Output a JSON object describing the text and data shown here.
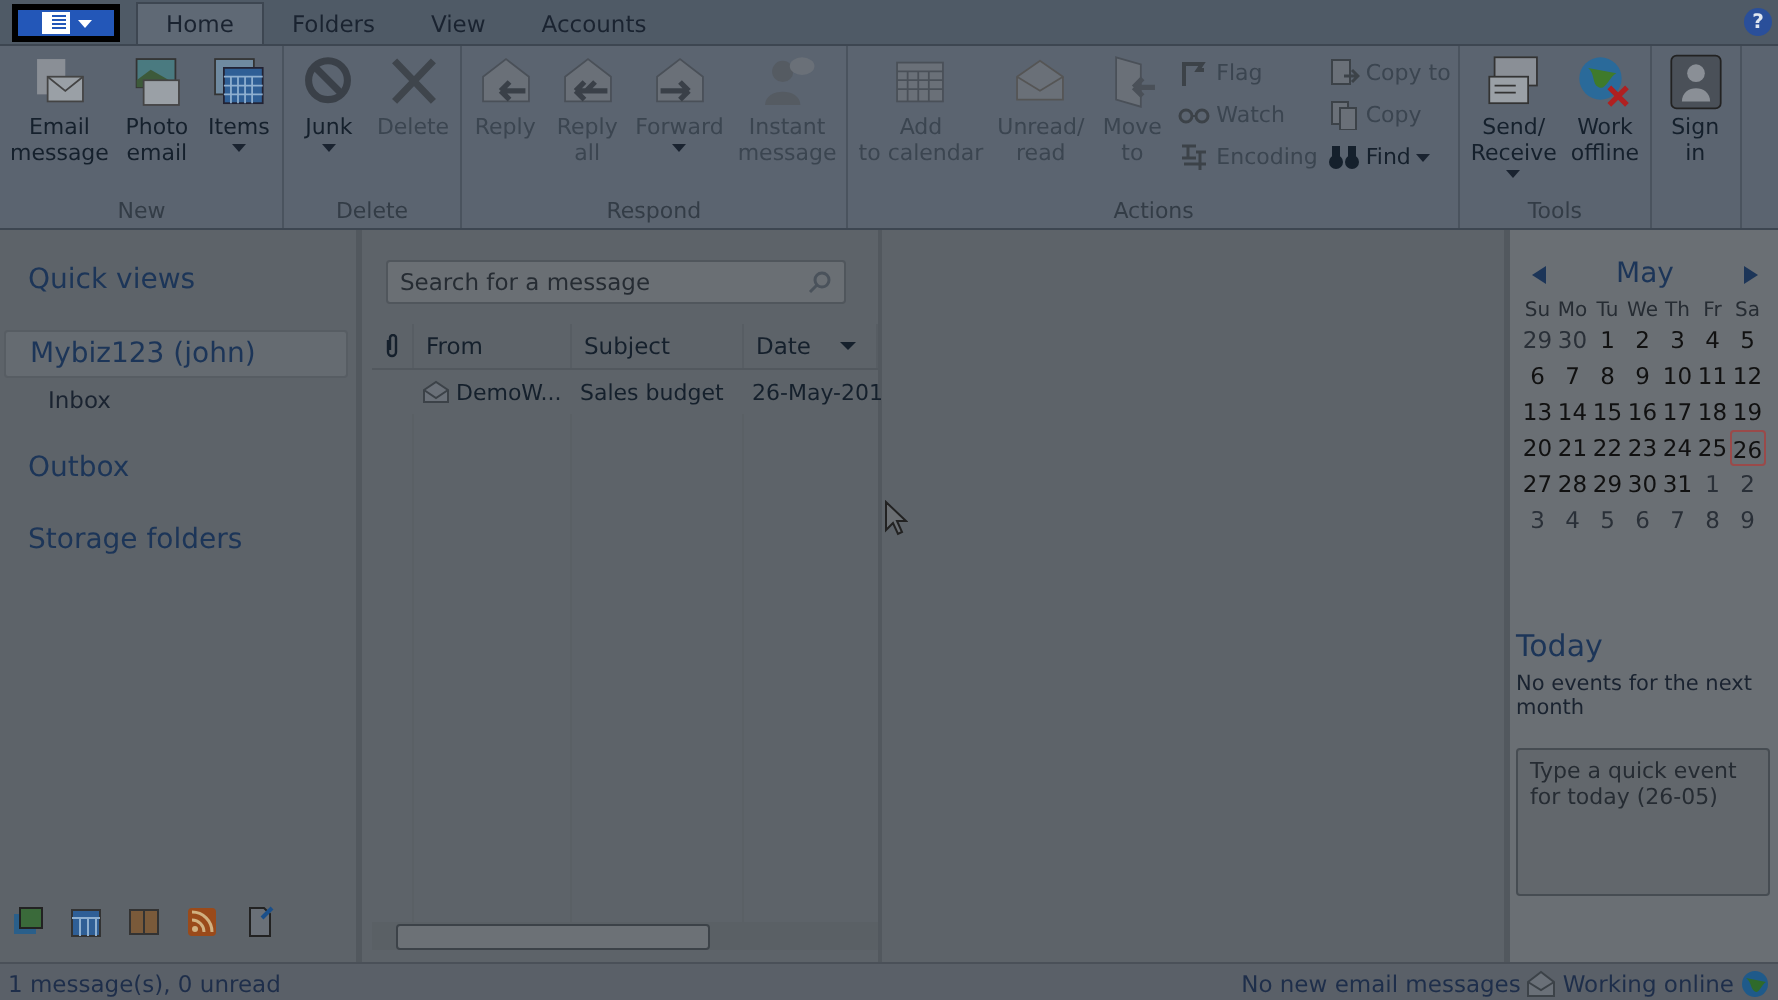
{
  "tabs": [
    {
      "label": "Home",
      "selected": true
    },
    {
      "label": "Folders",
      "selected": false
    },
    {
      "label": "View",
      "selected": false
    },
    {
      "label": "Accounts",
      "selected": false
    }
  ],
  "help_button": "?",
  "ribbon": [
    {
      "label": "New",
      "buttons": [
        {
          "kind": "large",
          "label": "Email message",
          "disabled": false,
          "dropdown": false
        },
        {
          "kind": "large",
          "label": "Photo email",
          "disabled": false,
          "dropdown": false
        },
        {
          "kind": "large",
          "label": "Items",
          "disabled": false,
          "dropdown": true
        }
      ]
    },
    {
      "label": "Delete",
      "buttons": [
        {
          "kind": "large",
          "label": "Junk",
          "disabled": false,
          "dropdown": true
        },
        {
          "kind": "large",
          "label": "Delete",
          "disabled": true,
          "dropdown": false
        }
      ]
    },
    {
      "label": "Respond",
      "buttons": [
        {
          "kind": "large",
          "label": "Reply",
          "disabled": true,
          "dropdown": false
        },
        {
          "kind": "large",
          "label": "Reply all",
          "disabled": true,
          "dropdown": false
        },
        {
          "kind": "large",
          "label": "Forward",
          "disabled": true,
          "dropdown": true
        },
        {
          "kind": "large",
          "label": "Instant message",
          "disabled": true,
          "dropdown": false
        }
      ]
    },
    {
      "label": "Actions",
      "buttons": [
        {
          "kind": "large",
          "label": "Add to calendar",
          "disabled": true,
          "dropdown": false
        },
        {
          "kind": "large",
          "label": "Unread/ read",
          "disabled": true,
          "dropdown": false
        },
        {
          "kind": "large",
          "label": "Move to",
          "disabled": true,
          "dropdown": false
        },
        {
          "kind": "small",
          "label": "Flag",
          "disabled": true,
          "dropdown": false
        },
        {
          "kind": "small",
          "label": "Watch",
          "disabled": true,
          "dropdown": false
        },
        {
          "kind": "small",
          "label": "Encoding",
          "disabled": true,
          "dropdown": false
        },
        {
          "kind": "small",
          "label": "Copy to",
          "disabled": true,
          "dropdown": false
        },
        {
          "kind": "small",
          "label": "Copy",
          "disabled": true,
          "dropdown": false
        },
        {
          "kind": "small",
          "label": "Find",
          "disabled": false,
          "dropdown": true
        }
      ]
    },
    {
      "label": "Tools",
      "buttons": [
        {
          "kind": "large",
          "label": "Send/ Receive",
          "disabled": false,
          "dropdown": true
        },
        {
          "kind": "large",
          "label": "Work offline",
          "disabled": false,
          "dropdown": false
        }
      ]
    },
    {
      "buttons": [
        {
          "kind": "large",
          "label": "Sign in",
          "disabled": false,
          "dropdown": false
        }
      ]
    }
  ],
  "sidebar": {
    "items": [
      {
        "label": "Quick views",
        "selected": false
      },
      {
        "label": "Mybiz123 (john)",
        "selected": true,
        "children": [
          {
            "label": "Inbox",
            "selected": false
          }
        ]
      },
      {
        "label": "Outbox",
        "selected": false
      },
      {
        "label": "Storage folders",
        "selected": false
      }
    ]
  },
  "search": {
    "placeholder": "Search for a message"
  },
  "table": {
    "columns": [
      "From",
      "Subject",
      "Date"
    ],
    "rows": [
      {
        "cells": [
          "DemoW...",
          "Sales budget",
          "26-May-201"
        ],
        "selected": false
      }
    ]
  },
  "calendar": {
    "month": "May",
    "weekdays": [
      "Su",
      "Mo",
      "Tu",
      "We",
      "Th",
      "Fr",
      "Sa"
    ],
    "weeks": [
      [
        {
          "day": "29",
          "muted": true,
          "selected": false
        },
        {
          "day": "30",
          "muted": true,
          "selected": false
        },
        {
          "day": "1",
          "muted": false,
          "selected": false
        },
        {
          "day": "2",
          "muted": false,
          "selected": false
        },
        {
          "day": "3",
          "muted": false,
          "selected": false
        },
        {
          "day": "4",
          "muted": false,
          "selected": false
        },
        {
          "day": "5",
          "muted": false,
          "selected": false
        }
      ],
      [
        {
          "day": "6",
          "muted": false,
          "selected": false
        },
        {
          "day": "7",
          "muted": false,
          "selected": false
        },
        {
          "day": "8",
          "muted": false,
          "selected": false
        },
        {
          "day": "9",
          "muted": false,
          "selected": false
        },
        {
          "day": "10",
          "muted": false,
          "selected": false
        },
        {
          "day": "11",
          "muted": false,
          "selected": false
        },
        {
          "day": "12",
          "muted": false,
          "selected": false
        }
      ],
      [
        {
          "day": "13",
          "muted": false,
          "selected": false
        },
        {
          "day": "14",
          "muted": false,
          "selected": false
        },
        {
          "day": "15",
          "muted": false,
          "selected": false
        },
        {
          "day": "16",
          "muted": false,
          "selected": false
        },
        {
          "day": "17",
          "muted": false,
          "selected": false
        },
        {
          "day": "18",
          "muted": false,
          "selected": false
        },
        {
          "day": "19",
          "muted": false,
          "selected": false
        }
      ],
      [
        {
          "day": "20",
          "muted": false,
          "selected": false
        },
        {
          "day": "21",
          "muted": false,
          "selected": false
        },
        {
          "day": "22",
          "muted": false,
          "selected": false
        },
        {
          "day": "23",
          "muted": false,
          "selected": false
        },
        {
          "day": "24",
          "muted": false,
          "selected": false
        },
        {
          "day": "25",
          "muted": false,
          "selected": false
        },
        {
          "day": "26",
          "muted": false,
          "selected": true
        }
      ],
      [
        {
          "day": "27",
          "muted": false,
          "selected": false
        },
        {
          "day": "28",
          "muted": false,
          "selected": false
        },
        {
          "day": "29",
          "muted": false,
          "selected": false
        },
        {
          "day": "30",
          "muted": false,
          "selected": false
        },
        {
          "day": "31",
          "muted": false,
          "selected": false
        },
        {
          "day": "1",
          "muted": true,
          "selected": false
        },
        {
          "day": "2",
          "muted": true,
          "selected": false
        }
      ],
      [
        {
          "day": "3",
          "muted": true,
          "selected": false
        },
        {
          "day": "4",
          "muted": true,
          "selected": false
        },
        {
          "day": "5",
          "muted": true,
          "selected": false
        },
        {
          "day": "6",
          "muted": true,
          "selected": false
        },
        {
          "day": "7",
          "muted": true,
          "selected": false
        },
        {
          "day": "8",
          "muted": true,
          "selected": false
        },
        {
          "day": "9",
          "muted": true,
          "selected": false
        }
      ]
    ]
  },
  "today": {
    "title": "Today",
    "text": "No events for the next month",
    "placeholder": "Type a quick event for today (26-05)"
  },
  "status_bar": {
    "left": "1 message(s), 0 unread",
    "mail": "No new email messages",
    "connection": "Working online"
  }
}
